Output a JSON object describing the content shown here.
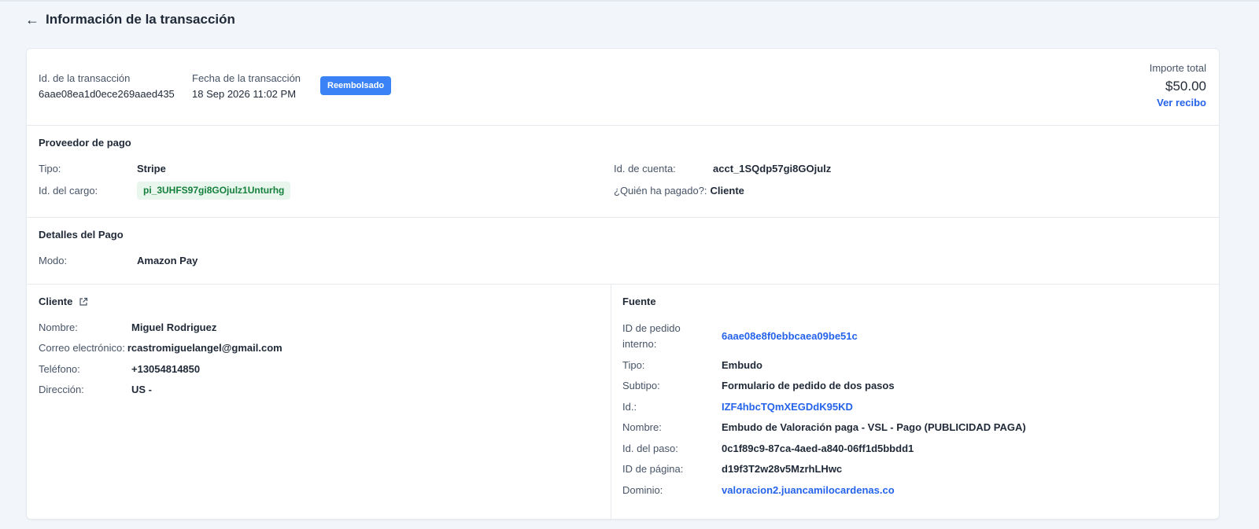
{
  "header": {
    "back_icon": "arrow-left-icon",
    "title": "Información de la transacción"
  },
  "transaction": {
    "id_label": "Id. de la transacción",
    "id_value": "6aae08ea1d0ece269aaed435",
    "date_label": "Fecha de la transacción",
    "date_value": "18 Sep 2026 11:02 PM",
    "status": "Reembolsado",
    "total_label": "Importe total",
    "total_value": "$50.00",
    "receipt_link": "Ver recibo"
  },
  "provider": {
    "title": "Proveedor de pago",
    "type_label": "Tipo:",
    "type_value": "Stripe",
    "charge_label": "Id. del cargo:",
    "charge_value": "pi_3UHFS97gi8GOjulz1Unturhg",
    "account_label": "Id. de cuenta:",
    "account_value": "acct_1SQdp57gi8GOjulz",
    "payer_label": "¿Quién ha pagado?:",
    "payer_value": "Cliente"
  },
  "payment": {
    "title": "Detalles del Pago",
    "mode_label": "Modo:",
    "mode_value": "Amazon Pay"
  },
  "client": {
    "title": "Cliente",
    "title_icon": "external-link-icon",
    "name_label": "Nombre:",
    "name_value": "Miguel Rodriguez",
    "email_label": "Correo electrónico:",
    "email_value": "rcastromiguelangel@gmail.com",
    "phone_label": "Teléfono:",
    "phone_value": "+13054814850",
    "address_label": "Dirección:",
    "address_value": "US -"
  },
  "source": {
    "title": "Fuente",
    "order_id_label_1": "ID de pedido",
    "order_id_label_2": "interno:",
    "order_id_value": "6aae08e8f0ebbcaea09be51c",
    "type_label": "Tipo:",
    "type_value": "Embudo",
    "subtype_label": "Subtipo:",
    "subtype_value": "Formulario de pedido de dos pasos",
    "id_label": "Id.:",
    "id_value": "IZF4hbcTQmXEGDdK95KD",
    "name_label": "Nombre:",
    "name_value": "Embudo de Valoración paga - VSL - Pago (PUBLICIDAD PAGA)",
    "step_label": "Id. del paso:",
    "step_value": "0c1f89c9-87ca-4aed-a840-06ff1d5bbdd1",
    "page_label": "ID de página:",
    "page_value": "d19f3T2w28v5MzrhLHwc",
    "domain_label": "Dominio:",
    "domain_value": "valoracion2.juancamilocardenas.co"
  },
  "colors": {
    "link": "#2563eb",
    "status_badge": "#3b82f6",
    "charge_badge_bg": "#e8f6ed",
    "charge_badge_text": "#15803d"
  }
}
